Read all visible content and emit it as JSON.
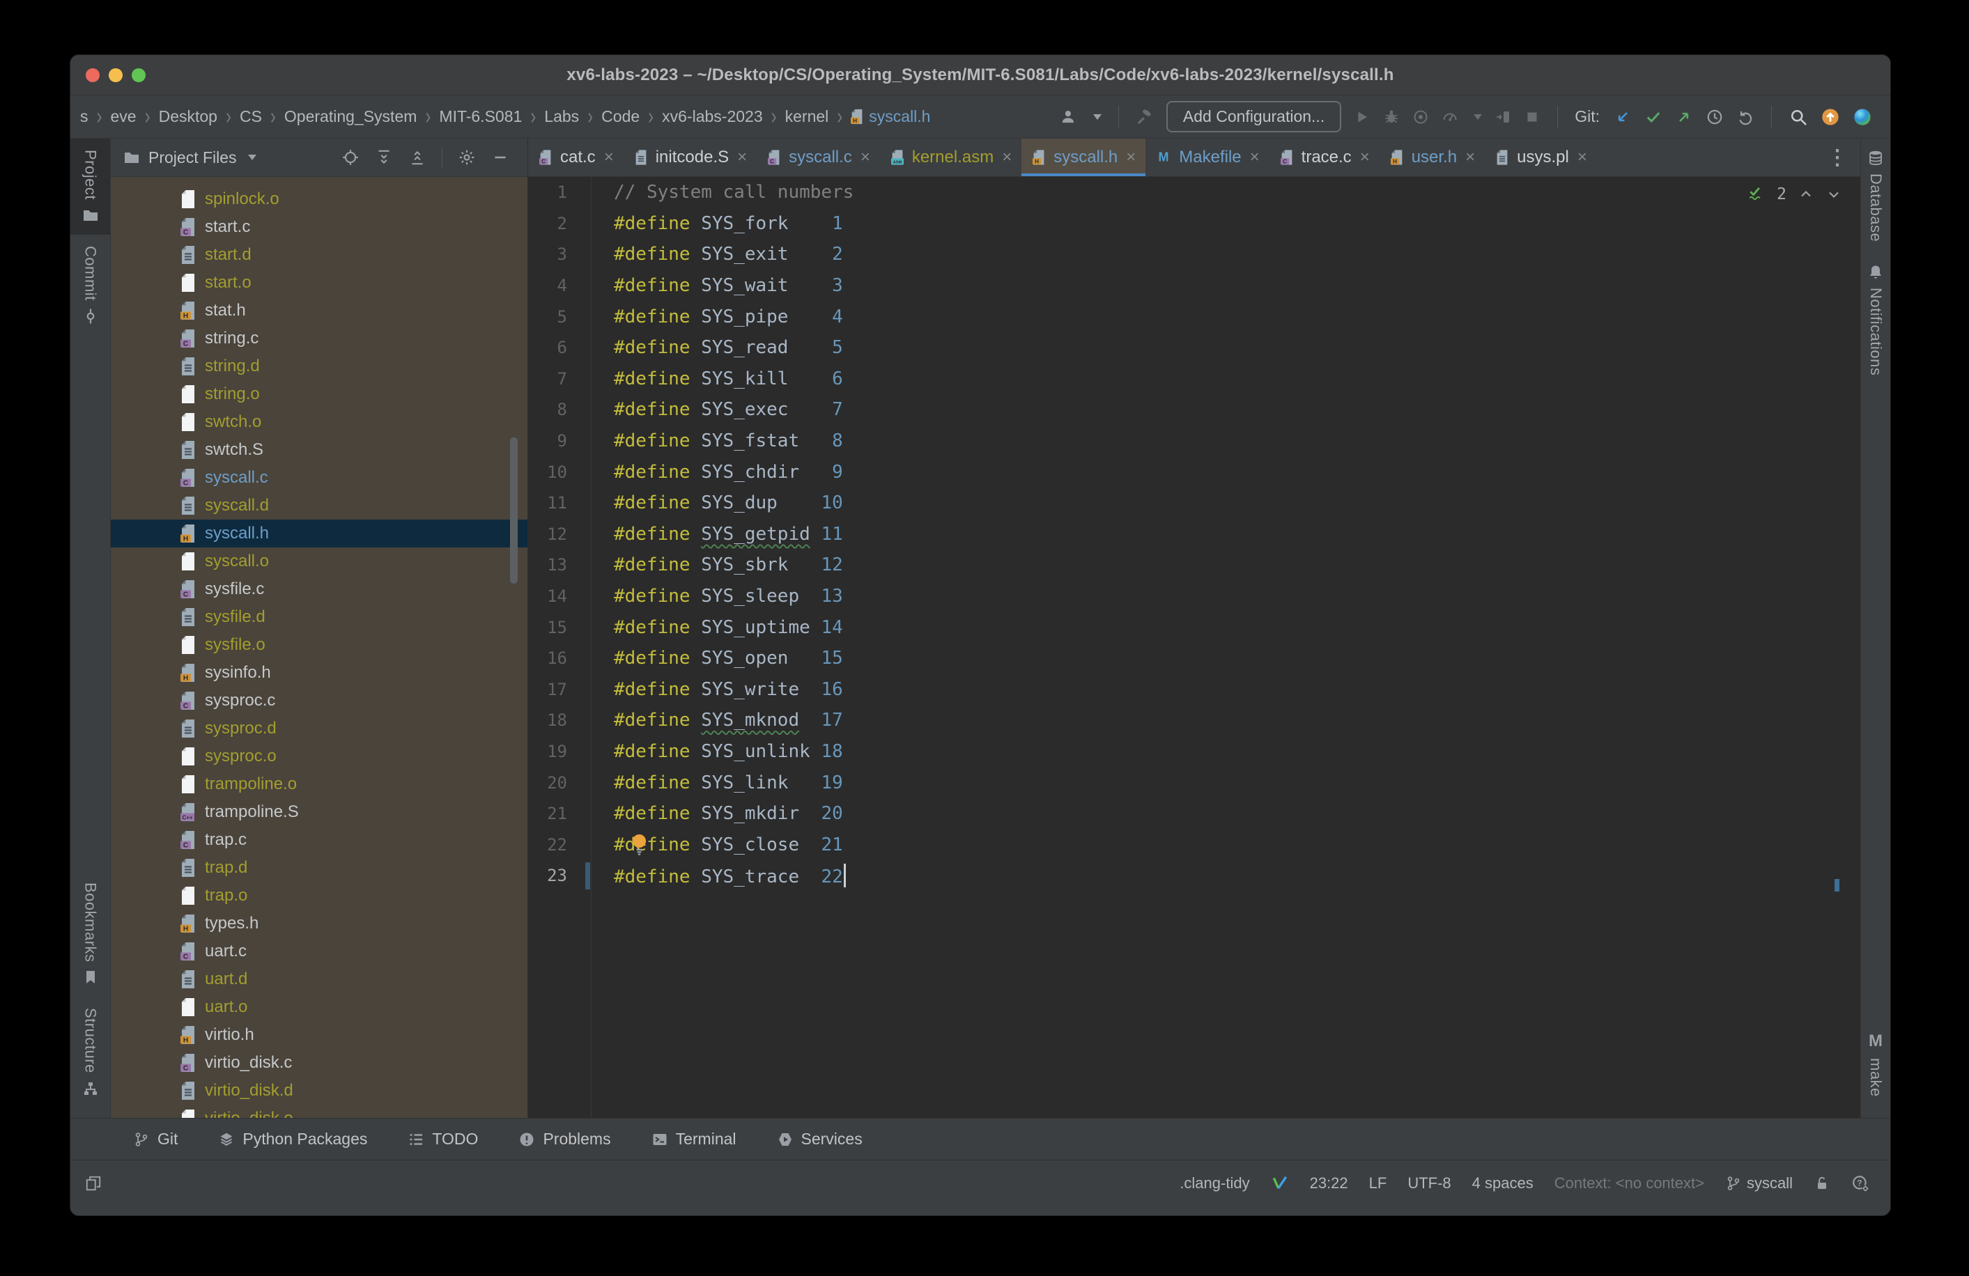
{
  "window": {
    "title": "xv6-labs-2023 – ~/Desktop/CS/Operating_System/MIT-6.S081/Labs/Code/xv6-labs-2023/kernel/syscall.h",
    "traffic_lights": [
      "close",
      "minimize",
      "zoom"
    ]
  },
  "colors": {
    "accent_blue": "#4a88c7",
    "modified_blue": "#6e9ec9",
    "ignored_olive": "#a39e2f",
    "selection_navy": "#0d2a3f",
    "h_chip_orange": "#cf9236",
    "c_chip_purple": "#9876aa",
    "asm_chip_teal": "#4db2be"
  },
  "toolbar": {
    "breadcrumbs": [
      "s",
      "eve",
      "Desktop",
      "CS",
      "Operating_System",
      "MIT-6.S081",
      "Labs",
      "Code",
      "xv6-labs-2023",
      "kernel"
    ],
    "current_crumb": "syscall.h",
    "add_configuration_label": "Add Configuration...",
    "git_label": "Git:",
    "run_icons": [
      "run",
      "debug",
      "coverage",
      "profiler",
      "attach",
      "stop"
    ],
    "git_icons": [
      "update",
      "commit-check",
      "push",
      "history",
      "rollback"
    ],
    "corner_icons": [
      "search",
      "upgrade",
      "globe"
    ]
  },
  "left_stripe": {
    "top": [
      {
        "label": "Project",
        "icon": "folder",
        "active": true
      },
      {
        "label": "Commit",
        "icon": "commit",
        "active": false
      }
    ],
    "bottom": [
      {
        "label": "Bookmarks",
        "icon": "bookmark",
        "active": false
      },
      {
        "label": "Structure",
        "icon": "structure",
        "active": false
      }
    ]
  },
  "right_stripe": {
    "top": [
      {
        "label": "Database",
        "icon": "database",
        "active": false
      },
      {
        "label": "Notifications",
        "icon": "bell",
        "active": false
      }
    ],
    "bottom": [
      {
        "label": "make",
        "icon": "make",
        "active": false
      }
    ]
  },
  "project_panel": {
    "title": "Project Files",
    "header_icons": [
      "locate",
      "expand-all",
      "collapse-all",
      "settings",
      "hide"
    ],
    "files": [
      {
        "name": "spinlock.o",
        "kind": "plain",
        "status": "ignored"
      },
      {
        "name": "start.c",
        "kind": "c",
        "status": "normal"
      },
      {
        "name": "start.d",
        "kind": "doc",
        "status": "ignored"
      },
      {
        "name": "start.o",
        "kind": "plain",
        "status": "ignored"
      },
      {
        "name": "stat.h",
        "kind": "h",
        "status": "normal"
      },
      {
        "name": "string.c",
        "kind": "c",
        "status": "normal"
      },
      {
        "name": "string.d",
        "kind": "doc",
        "status": "ignored"
      },
      {
        "name": "string.o",
        "kind": "plain",
        "status": "ignored"
      },
      {
        "name": "swtch.o",
        "kind": "plain",
        "status": "ignored"
      },
      {
        "name": "swtch.S",
        "kind": "doc",
        "status": "normal"
      },
      {
        "name": "syscall.c",
        "kind": "c",
        "status": "modified"
      },
      {
        "name": "syscall.d",
        "kind": "doc",
        "status": "ignored"
      },
      {
        "name": "syscall.h",
        "kind": "h",
        "status": "modified",
        "selected": true
      },
      {
        "name": "syscall.o",
        "kind": "plain",
        "status": "ignored"
      },
      {
        "name": "sysfile.c",
        "kind": "c",
        "status": "normal"
      },
      {
        "name": "sysfile.d",
        "kind": "doc",
        "status": "ignored"
      },
      {
        "name": "sysfile.o",
        "kind": "plain",
        "status": "ignored"
      },
      {
        "name": "sysinfo.h",
        "kind": "h",
        "status": "normal"
      },
      {
        "name": "sysproc.c",
        "kind": "c",
        "status": "normal"
      },
      {
        "name": "sysproc.d",
        "kind": "doc",
        "status": "ignored"
      },
      {
        "name": "sysproc.o",
        "kind": "plain",
        "status": "ignored"
      },
      {
        "name": "trampoline.o",
        "kind": "plain",
        "status": "ignored"
      },
      {
        "name": "trampoline.S",
        "kind": "cpp",
        "status": "normal"
      },
      {
        "name": "trap.c",
        "kind": "c",
        "status": "normal"
      },
      {
        "name": "trap.d",
        "kind": "doc",
        "status": "ignored"
      },
      {
        "name": "trap.o",
        "kind": "plain",
        "status": "ignored"
      },
      {
        "name": "types.h",
        "kind": "h",
        "status": "normal"
      },
      {
        "name": "uart.c",
        "kind": "c",
        "status": "normal"
      },
      {
        "name": "uart.d",
        "kind": "doc",
        "status": "ignored"
      },
      {
        "name": "uart.o",
        "kind": "plain",
        "status": "ignored"
      },
      {
        "name": "virtio.h",
        "kind": "h",
        "status": "normal"
      },
      {
        "name": "virtio_disk.c",
        "kind": "c",
        "status": "normal"
      },
      {
        "name": "virtio_disk.d",
        "kind": "doc",
        "status": "ignored"
      },
      {
        "name": "virtio_disk.o",
        "kind": "plain",
        "status": "ignored"
      }
    ]
  },
  "editor": {
    "tabs": [
      {
        "label": "cat.c",
        "kind": "c",
        "status": "normal",
        "active": false
      },
      {
        "label": "initcode.S",
        "kind": "doc",
        "status": "normal",
        "active": false
      },
      {
        "label": "syscall.c",
        "kind": "c",
        "status": "modified",
        "active": false
      },
      {
        "label": "kernel.asm",
        "kind": "asm",
        "status": "ignored",
        "active": false
      },
      {
        "label": "syscall.h",
        "kind": "h",
        "status": "modified",
        "active": true
      },
      {
        "label": "Makefile",
        "kind": "mk",
        "status": "modified",
        "active": false
      },
      {
        "label": "trace.c",
        "kind": "c",
        "status": "normal",
        "active": false
      },
      {
        "label": "user.h",
        "kind": "h",
        "status": "modified",
        "active": false
      },
      {
        "label": "usys.pl",
        "kind": "doc",
        "status": "normal",
        "active": false
      }
    ],
    "tabs_overflow_icon": "⋮",
    "inspection_count": "2",
    "lines": [
      {
        "num": "1",
        "comment": "// System call numbers"
      },
      {
        "num": "2",
        "name": "SYS_fork",
        "pad": "    ",
        "value": "1"
      },
      {
        "num": "3",
        "name": "SYS_exit",
        "pad": "    ",
        "value": "2"
      },
      {
        "num": "4",
        "name": "SYS_wait",
        "pad": "    ",
        "value": "3"
      },
      {
        "num": "5",
        "name": "SYS_pipe",
        "pad": "    ",
        "value": "4"
      },
      {
        "num": "6",
        "name": "SYS_read",
        "pad": "    ",
        "value": "5"
      },
      {
        "num": "7",
        "name": "SYS_kill",
        "pad": "    ",
        "value": "6"
      },
      {
        "num": "8",
        "name": "SYS_exec",
        "pad": "    ",
        "value": "7"
      },
      {
        "num": "9",
        "name": "SYS_fstat",
        "pad": "   ",
        "value": "8"
      },
      {
        "num": "10",
        "name": "SYS_chdir",
        "pad": "   ",
        "value": "9"
      },
      {
        "num": "11",
        "name": "SYS_dup",
        "pad": "    ",
        "value": "10"
      },
      {
        "num": "12",
        "name": "SYS_getpid",
        "pad": " ",
        "value": "11",
        "underline": true
      },
      {
        "num": "13",
        "name": "SYS_sbrk",
        "pad": "   ",
        "value": "12"
      },
      {
        "num": "14",
        "name": "SYS_sleep",
        "pad": "  ",
        "value": "13"
      },
      {
        "num": "15",
        "name": "SYS_uptime",
        "pad": " ",
        "value": "14"
      },
      {
        "num": "16",
        "name": "SYS_open",
        "pad": "   ",
        "value": "15"
      },
      {
        "num": "17",
        "name": "SYS_write",
        "pad": "  ",
        "value": "16"
      },
      {
        "num": "18",
        "name": "SYS_mknod",
        "pad": "  ",
        "value": "17",
        "underline": true
      },
      {
        "num": "19",
        "name": "SYS_unlink",
        "pad": " ",
        "value": "18"
      },
      {
        "num": "20",
        "name": "SYS_link",
        "pad": "   ",
        "value": "19"
      },
      {
        "num": "21",
        "name": "SYS_mkdir",
        "pad": "  ",
        "value": "20"
      },
      {
        "num": "22",
        "name": "SYS_close",
        "pad": "  ",
        "value": "21",
        "bulb": true
      },
      {
        "num": "23",
        "name": "SYS_trace",
        "pad": "  ",
        "value": "22",
        "caret": true,
        "change": true,
        "active_num": true
      }
    ]
  },
  "bottom_bar": {
    "items": [
      {
        "label": "Git",
        "icon": "git-branch"
      },
      {
        "label": "Python Packages",
        "icon": "layers"
      },
      {
        "label": "TODO",
        "icon": "todo"
      },
      {
        "label": "Problems",
        "icon": "problems"
      },
      {
        "label": "Terminal",
        "icon": "terminal"
      },
      {
        "label": "Services",
        "icon": "services"
      }
    ]
  },
  "status_bar": {
    "clang_tidy": ".clang-tidy",
    "caret_position": "23:22",
    "line_separator": "LF",
    "encoding": "UTF-8",
    "indent": "4 spaces",
    "context": "Context: <no context>",
    "branch": "syscall"
  }
}
